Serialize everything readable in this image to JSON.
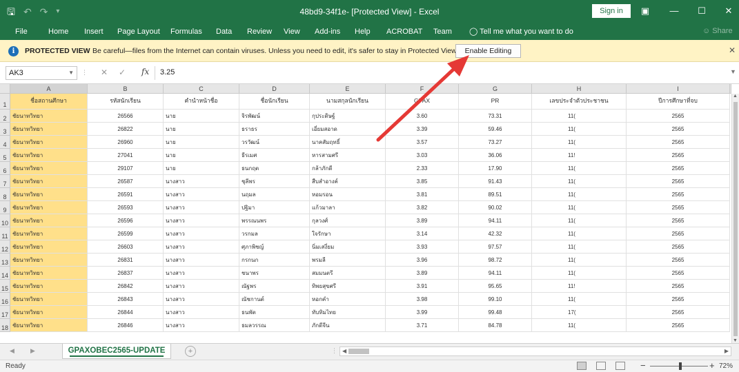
{
  "titlebar": {
    "save_icon": "save-icon",
    "undo_icon": "undo-icon",
    "redo_icon": "redo-icon",
    "title": "48bd9-34f1e- [Protected View] - Excel",
    "sign_in": "Sign in"
  },
  "ribbon": {
    "tabs": [
      "File",
      "Home",
      "Insert",
      "Page Layout",
      "Formulas",
      "Data",
      "Review",
      "View",
      "Add-ins",
      "Help",
      "ACROBAT",
      "Team"
    ],
    "tell_me": "Tell me what you want to do",
    "share": "Share"
  },
  "protected_view": {
    "title": "PROTECTED VIEW",
    "message": "Be careful—files from the Internet can contain viruses. Unless you need to edit, it's safer to stay in Protected View.",
    "enable_label": "Enable Editing"
  },
  "formula_bar": {
    "name_box": "AK3",
    "fx": "fx",
    "value": "3.25"
  },
  "sheet": {
    "columns": [
      "A",
      "B",
      "C",
      "D",
      "E",
      "F",
      "G",
      "H",
      "I"
    ],
    "header_row": [
      "ชื่อสถานศึกษา",
      "รหัสนักเรียน",
      "คำนำหน้าชื่อ",
      "ชื่อนักเรียน",
      "นามสกุลนักเรียน",
      "GPAX",
      "PR",
      "เลขประจำตัวประชาชน",
      "ปีการศึกษาที่จบ"
    ],
    "rows": [
      {
        "n": "2",
        "cells": [
          "ชัยนาทวิทยา",
          "26566",
          "นาย",
          "จิรพัฒน์",
          "กุประดิษฐ์",
          "3.60",
          "73.31",
          "11(",
          "2565"
        ]
      },
      {
        "n": "3",
        "cells": [
          "ชัยนาทวิทยา",
          "26822",
          "นาย",
          "ธราธร",
          "เอี่ยมสอาด",
          "3.39",
          "59.46",
          "11(",
          "2565"
        ]
      },
      {
        "n": "4",
        "cells": [
          "ชัยนาทวิทยา",
          "26960",
          "นาย",
          "วรวัฒน์",
          "นาคสัมฤทธิ์",
          "3.57",
          "73.27",
          "11(",
          "2565"
        ]
      },
      {
        "n": "5",
        "cells": [
          "ชัยนาทวิทยา",
          "27041",
          "นาย",
          "ธีรเมศ",
          "หารสามศรี",
          "3.03",
          "36.06",
          "11!",
          "2565"
        ]
      },
      {
        "n": "6",
        "cells": [
          "ชัยนาทวิทยา",
          "29107",
          "นาย",
          "ธนกฤต",
          "กล้าภักดี",
          "2.33",
          "17.90",
          "11(",
          "2565"
        ]
      },
      {
        "n": "7",
        "cells": [
          "ชัยนาทวิทยา",
          "26587",
          "นางสาว",
          "ชุลีพร",
          "สืบสำอางค์",
          "3.85",
          "91.43",
          "11(",
          "2565"
        ]
      },
      {
        "n": "8",
        "cells": [
          "ชัยนาทวิทยา",
          "26591",
          "นางสาว",
          "นฤมล",
          "หอมรอน",
          "3.81",
          "89.51",
          "11(",
          "2565"
        ]
      },
      {
        "n": "9",
        "cells": [
          "ชัยนาทวิทยา",
          "26593",
          "นางสาว",
          "ปฐิมา",
          "แก้วมาลา",
          "3.82",
          "90.02",
          "11(",
          "2565"
        ]
      },
      {
        "n": "10",
        "cells": [
          "ชัยนาทวิทยา",
          "26596",
          "นางสาว",
          "พรรณนพร",
          "กุลวงศ์",
          "3.89",
          "94.11",
          "11(",
          "2565"
        ]
      },
      {
        "n": "11",
        "cells": [
          "ชัยนาทวิทยา",
          "26599",
          "นางสาว",
          "วรกมล",
          "ใจรักษา",
          "3.14",
          "42.32",
          "11(",
          "2565"
        ]
      },
      {
        "n": "12",
        "cells": [
          "ชัยนาทวิทยา",
          "26603",
          "นางสาว",
          "ศุภาพิชญ์",
          "นิ่มเสงี่ยม",
          "3.93",
          "97.57",
          "11(",
          "2565"
        ]
      },
      {
        "n": "13",
        "cells": [
          "ชัยนาทวิทยา",
          "26831",
          "นางสาว",
          "กรกนก",
          "พรมลี",
          "3.96",
          "98.72",
          "11(",
          "2565"
        ]
      },
      {
        "n": "14",
        "cells": [
          "ชัยนาทวิทยา",
          "26837",
          "นางสาว",
          "ชนาพร",
          "สมมนตรี",
          "3.89",
          "94.11",
          "11(",
          "2565"
        ]
      },
      {
        "n": "15",
        "cells": [
          "ชัยนาทวิทยา",
          "26842",
          "นางสาว",
          "ณัฐพร",
          "ทิพยสุขศรี",
          "3.91",
          "95.65",
          "11!",
          "2565"
        ]
      },
      {
        "n": "16",
        "cells": [
          "ชัยนาทวิทยา",
          "26843",
          "นางสาว",
          "ณัชกานต์",
          "หอกคำ",
          "3.98",
          "99.10",
          "11(",
          "2565"
        ]
      },
      {
        "n": "17",
        "cells": [
          "ชัยนาทวิทยา",
          "26844",
          "นางสาว",
          "ธนพัต",
          "ทับทิมไทย",
          "3.99",
          "99.48",
          "17(",
          "2565"
        ]
      },
      {
        "n": "18",
        "cells": [
          "ชัยนาทวิทยา",
          "26846",
          "นางสาว",
          "ธมลวรรณ",
          "ภักดีจีน",
          "3.71",
          "84.78",
          "11(",
          "2565"
        ]
      }
    ]
  },
  "sheet_tabs": {
    "active": "GPAXOBEC2565-UPDATE",
    "add": "+"
  },
  "status": {
    "ready": "Ready",
    "zoom": "72%",
    "zoom_minus": "−",
    "zoom_plus": "+"
  }
}
